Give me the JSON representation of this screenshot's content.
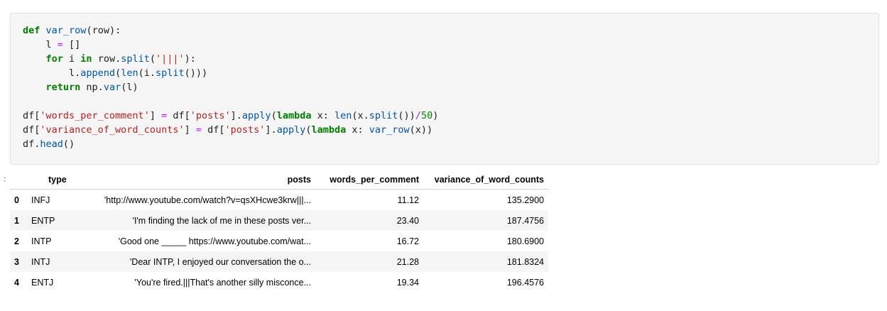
{
  "code_lines": [
    "def var_row(row):",
    "    l = []",
    "    for i in row.split('|||'):",
    "        l.append(len(i.split()))",
    "    return np.var(l)",
    "",
    "df['words_per_comment'] = df['posts'].apply(lambda x: len(x.split())/50)",
    "df['variance_of_word_counts'] = df['posts'].apply(lambda x: var_row(x))",
    "df.head()"
  ],
  "output_prompt": ":",
  "table": {
    "columns": [
      "type",
      "posts",
      "words_per_comment",
      "variance_of_word_counts"
    ],
    "rows": [
      {
        "index": "0",
        "type": "INFJ",
        "posts": "'http://www.youtube.com/watch?v=qsXHcwe3krw|||...",
        "words_per_comment": "11.12",
        "variance_of_word_counts": "135.2900"
      },
      {
        "index": "1",
        "type": "ENTP",
        "posts": "'I'm finding the lack of me in these posts ver...",
        "words_per_comment": "23.40",
        "variance_of_word_counts": "187.4756"
      },
      {
        "index": "2",
        "type": "INTP",
        "posts": "'Good one _____ https://www.youtube.com/wat...",
        "words_per_comment": "16.72",
        "variance_of_word_counts": "180.6900"
      },
      {
        "index": "3",
        "type": "INTJ",
        "posts": "'Dear INTP, I enjoyed our conversation the o...",
        "words_per_comment": "21.28",
        "variance_of_word_counts": "181.8324"
      },
      {
        "index": "4",
        "type": "ENTJ",
        "posts": "'You're fired.|||That's another silly misconce...",
        "words_per_comment": "19.34",
        "variance_of_word_counts": "196.4576"
      }
    ]
  }
}
